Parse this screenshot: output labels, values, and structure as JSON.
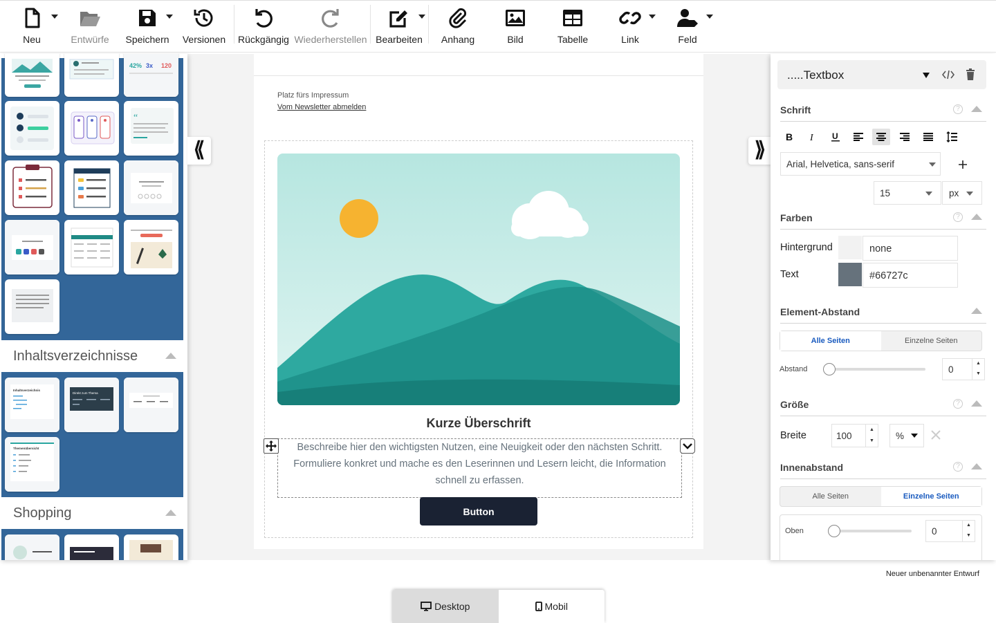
{
  "toolbar": {
    "new": "Neu",
    "drafts": "Entwürfe",
    "save": "Speichern",
    "versions": "Versionen",
    "undo": "Rückgängig",
    "redo": "Wiederherstellen",
    "edit": "Bearbeiten",
    "attachment": "Anhang",
    "image": "Bild",
    "table": "Tabelle",
    "link": "Link",
    "field": "Feld"
  },
  "left_panel": {
    "toc_title": "Inhaltsverzeichnisse",
    "shopping_title": "Shopping",
    "toc_thumb_1_title": "Inhaltsverzeichnis",
    "toc_thumb_2_title": "Direkt zum Thema",
    "toc_thumb_4_title": "Themenübersicht"
  },
  "email": {
    "impressum": "Platz fürs Impressum",
    "unsubscribe": "Vom Newsletter abmelden",
    "headline": "Kurze Überschrift",
    "body": "Beschreibe hier den wichtigsten Nutzen, eine Neuigkeit oder den nächsten Schritt. Formuliere konkret und mache es den Leserinnen und Lesern leicht, die Information schnell zu erfassen.",
    "button": "Button"
  },
  "right_panel": {
    "element_type": ".....Textbox",
    "font_section": "Schrift",
    "font_family": "Arial, Helvetica, sans-serif",
    "font_size": "15",
    "font_unit": "px",
    "colors_section": "Farben",
    "bg_label": "Hintergrund",
    "bg_value": "none",
    "text_label": "Text",
    "text_value": "#66727c",
    "spacing_section": "Element-Abstand",
    "all_sides": "Alle Seiten",
    "single_sides": "Einzelne Seiten",
    "distance_label": "Abstand",
    "distance_value": "0",
    "size_section": "Größe",
    "width_label": "Breite",
    "width_value": "100",
    "width_unit": "%",
    "padding_section": "Innenabstand",
    "top_label": "Oben",
    "top_value": "0"
  },
  "footer": {
    "draft_name": "Neuer unbenannter Entwurf",
    "desktop": "Desktop",
    "mobile": "Mobil"
  },
  "colors": {
    "panel_blue": "#336699",
    "button_dark": "#1a2233",
    "text_color": "#66727c",
    "accent_blue": "#1a5bbf"
  }
}
